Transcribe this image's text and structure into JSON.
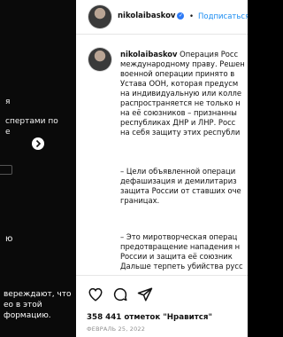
{
  "media_overlay": {
    "caption_lines": [
      "я",
      "спертами по",
      "е"
    ],
    "sensitive_title": "ю",
    "sensitive_lines": [
      "вереждают, что",
      "ео в этой",
      "формацию."
    ]
  },
  "header": {
    "username": "nikolaibaskov",
    "separator": "•",
    "follow_label": "Подписаться"
  },
  "comment": {
    "username": "nikolaibaskov",
    "lines": [
      " Операция Росс",
      "международному праву. Решен",
      "военной операции принято в",
      "Устава ООН, которая предусм",
      "на индивидуальную или колле",
      "распространяется не только н",
      "на её союзников – признанны",
      "республиках ДНР и ЛНР. Росс",
      "на себя защиту этих республи",
      "",
      "– Цели объявленной операци",
      "дефашизация и демилитариз",
      "защита России от ставших оче",
      "границах.",
      "",
      "– Это миротворческая операц",
      "предотвращение нападения н",
      "России и защита её союзник",
      "Дальше терпеть убийства русс"
    ]
  },
  "actions": {
    "like_icon": "heart-icon",
    "comment_icon": "comment-icon",
    "share_icon": "share-icon",
    "likes_count": "358 441",
    "likes_text": "отметок \"Нравится\"",
    "date": "ФЕВРАЛЬ 25, 2022"
  }
}
